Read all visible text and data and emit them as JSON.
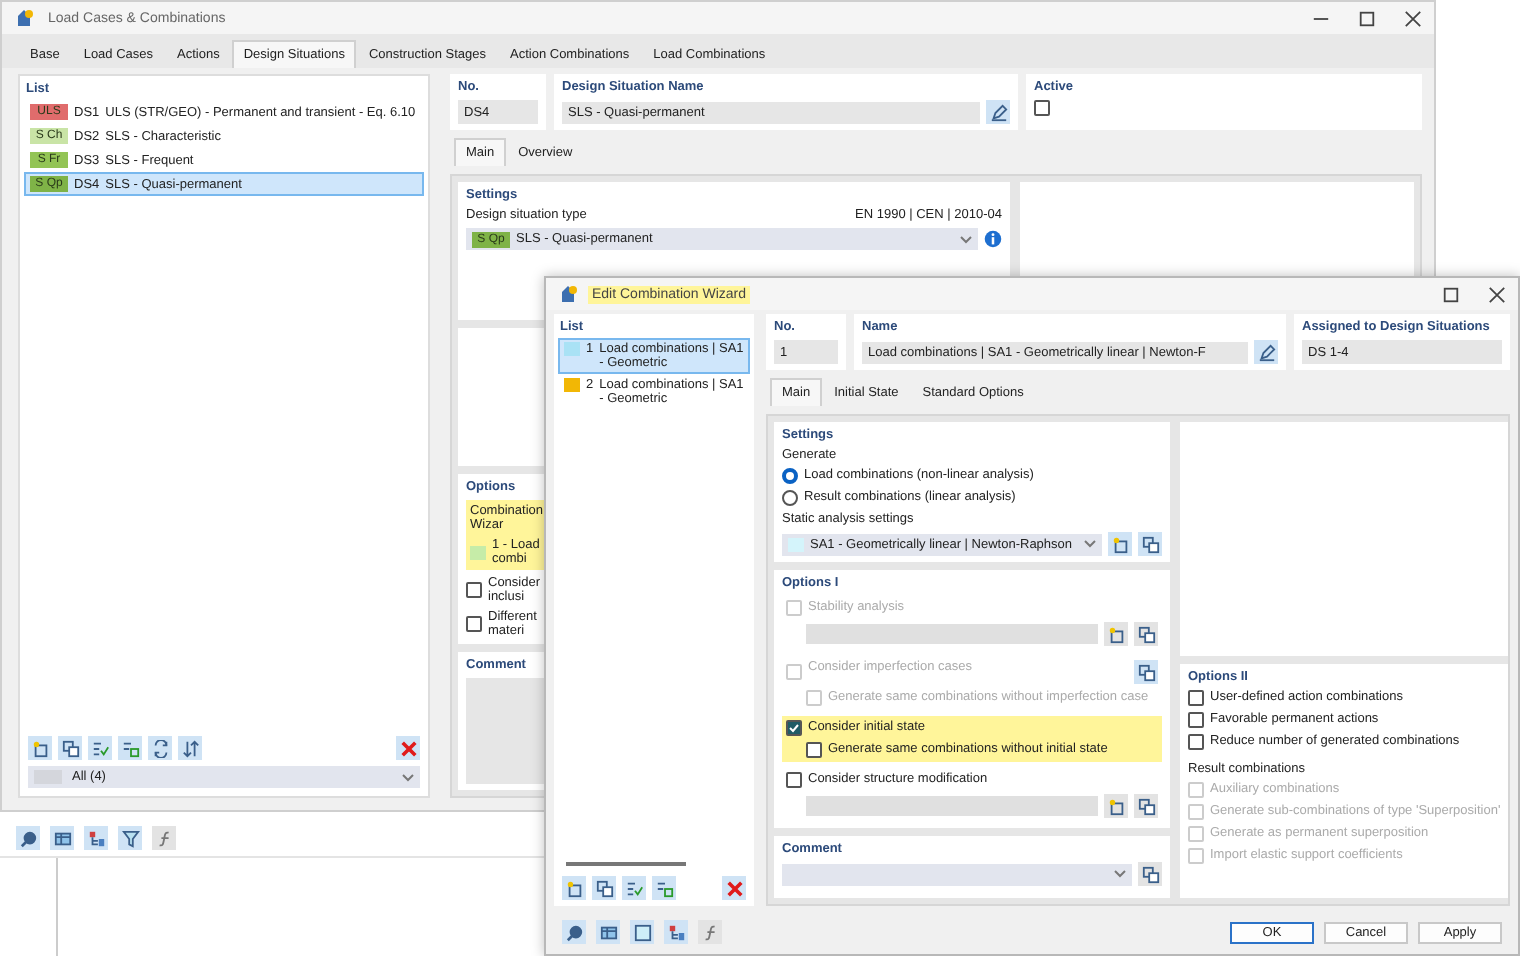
{
  "main_window": {
    "title": "Load Cases & Combinations",
    "tabs": [
      {
        "label": "Base",
        "selected": false
      },
      {
        "label": "Load Cases",
        "selected": false
      },
      {
        "label": "Actions",
        "selected": false
      },
      {
        "label": "Design Situations",
        "selected": true
      },
      {
        "label": "Construction Stages",
        "selected": false
      },
      {
        "label": "Action Combinations",
        "selected": false
      },
      {
        "label": "Load Combinations",
        "selected": false
      }
    ],
    "list": {
      "header": "List",
      "items": [
        {
          "badge": "ULS",
          "color": "#e06c6c",
          "number": "DS1",
          "name": "ULS (STR/GEO) - Permanent and transient - Eq. 6.10",
          "selected": false
        },
        {
          "badge": "S Ch",
          "color": "#c9e4a6",
          "number": "DS2",
          "name": "SLS - Characteristic",
          "selected": false
        },
        {
          "badge": "S Fr",
          "color": "#93c455",
          "number": "DS3",
          "name": "SLS - Frequent",
          "selected": false
        },
        {
          "badge": "S Qp",
          "color": "#7fb347",
          "number": "DS4",
          "name": "SLS - Quasi-permanent",
          "selected": true
        }
      ],
      "filter": "All (4)"
    },
    "no": {
      "label": "No.",
      "value": "DS4"
    },
    "name": {
      "label": "Design Situation Name",
      "value": "SLS - Quasi-permanent"
    },
    "active": {
      "label": "Active",
      "checked": false
    },
    "subtabs": [
      {
        "label": "Main",
        "selected": true
      },
      {
        "label": "Overview",
        "selected": false
      }
    ],
    "settings": {
      "title": "Settings",
      "type_label": "Design situation type",
      "standard": "EN 1990 | CEN | 2010-04",
      "type": {
        "badge": "S Qp",
        "color": "#7fb347",
        "value": "SLS - Quasi-permanent"
      }
    },
    "options": {
      "title": "Options",
      "wizard": {
        "label": "Combination Wizar",
        "value": "1 - Load combi",
        "highlighted": true
      },
      "checks": [
        {
          "label": "Consider inclusi",
          "checked": false
        },
        {
          "label": "Different materi",
          "checked": false
        }
      ]
    },
    "comment": {
      "label": "Comment"
    }
  },
  "dialog": {
    "title": "Edit Combination Wizard",
    "title_highlighted": true,
    "list": {
      "header": "List",
      "items": [
        {
          "number": "1",
          "name": "Load combinations | SA1 - Geometric",
          "color": "#a9e2f5",
          "selected": true
        },
        {
          "number": "2",
          "name": "Load combinations | SA1 - Geometric",
          "color": "#f2b705",
          "selected": false
        }
      ]
    },
    "no": {
      "label": "No.",
      "value": "1"
    },
    "name": {
      "label": "Name",
      "value": "Load combinations | SA1 - Geometrically linear | Newton-F"
    },
    "assigned": {
      "label": "Assigned to Design Situations",
      "value": "DS 1-4"
    },
    "tabs": [
      {
        "label": "Main",
        "selected": true
      },
      {
        "label": "Initial State",
        "selected": false
      },
      {
        "label": "Standard Options",
        "selected": false
      }
    ],
    "settings": {
      "title": "Settings",
      "generate_label": "Generate",
      "generate_options": [
        {
          "label": "Load combinations (non-linear analysis)",
          "selected": true
        },
        {
          "label": "Result combinations (linear analysis)",
          "selected": false
        }
      ],
      "static_label": "Static analysis settings",
      "static_value": "SA1 - Geometrically linear | Newton-Raphson"
    },
    "options_1": {
      "title": "Options I",
      "items": [
        {
          "kind": "with-field",
          "label": "Stability analysis",
          "checked": false,
          "disabled": true,
          "highlighted": false
        },
        {
          "kind": "with-button",
          "label": "Consider imperfection cases",
          "checked": false,
          "disabled": true,
          "highlighted": false,
          "children": [
            {
              "label": "Generate same combinations without imperfection case",
              "checked": false,
              "disabled": true
            }
          ]
        },
        {
          "kind": "plain",
          "label": "Consider initial state",
          "checked": true,
          "disabled": false,
          "highlighted": true,
          "children": [
            {
              "label": "Generate same combinations without initial state",
              "checked": false,
              "disabled": false
            }
          ]
        },
        {
          "kind": "with-field",
          "label": "Consider structure modification",
          "checked": false,
          "disabled": false,
          "highlighted": false
        }
      ]
    },
    "options_2": {
      "title": "Options II",
      "items": [
        {
          "label": "User-defined action combinations",
          "checked": false,
          "disabled": false
        },
        {
          "label": "Favorable permanent actions",
          "checked": false,
          "disabled": false
        },
        {
          "label": "Reduce number of generated combinations",
          "checked": false,
          "disabled": false
        }
      ],
      "result_label": "Result combinations",
      "result_items": [
        {
          "label": "Auxiliary combinations",
          "checked": false,
          "disabled": true
        },
        {
          "label": "Generate sub-combinations of type 'Superposition'",
          "checked": false,
          "disabled": true
        },
        {
          "label": "Generate as permanent superposition",
          "checked": false,
          "disabled": true
        },
        {
          "label": "Import elastic support coefficients",
          "checked": false,
          "disabled": true
        }
      ]
    },
    "comment": {
      "label": "Comment"
    },
    "buttons": [
      {
        "label": "OK",
        "default": true
      },
      {
        "label": "Cancel",
        "default": false
      },
      {
        "label": "Apply",
        "default": false
      }
    ]
  }
}
